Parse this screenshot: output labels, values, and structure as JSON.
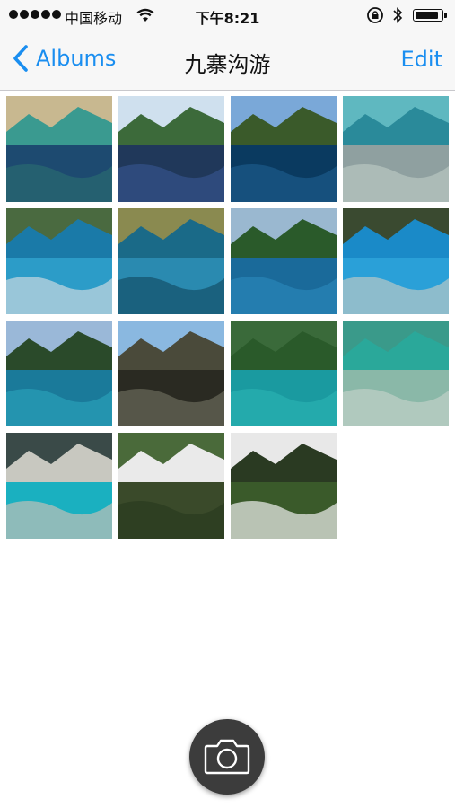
{
  "status_bar": {
    "carrier": "中国移动",
    "time": "下午8:21",
    "battery_level": 0.95
  },
  "nav": {
    "back_label": "Albums",
    "title": "九寨沟游",
    "edit_label": "Edit"
  },
  "accent_color": "#1a8ef0",
  "photos": [
    {
      "icon": "photo-turquoise-lake"
    },
    {
      "icon": "photo-mountain-lake"
    },
    {
      "icon": "photo-mountain-reflection"
    },
    {
      "icon": "photo-underwater-logs"
    },
    {
      "icon": "photo-blue-lake-trees"
    },
    {
      "icon": "photo-lake-reflection"
    },
    {
      "icon": "photo-forest-reflection"
    },
    {
      "icon": "photo-blue-pool-branches"
    },
    {
      "icon": "photo-valley-lake"
    },
    {
      "icon": "photo-rocky-waterfall"
    },
    {
      "icon": "photo-forest-lake"
    },
    {
      "icon": "photo-clear-water"
    },
    {
      "icon": "photo-turquoise-shore"
    },
    {
      "icon": "photo-waterfall-wide"
    },
    {
      "icon": "photo-waterfall-stream"
    }
  ],
  "camera_icon": "camera-icon"
}
